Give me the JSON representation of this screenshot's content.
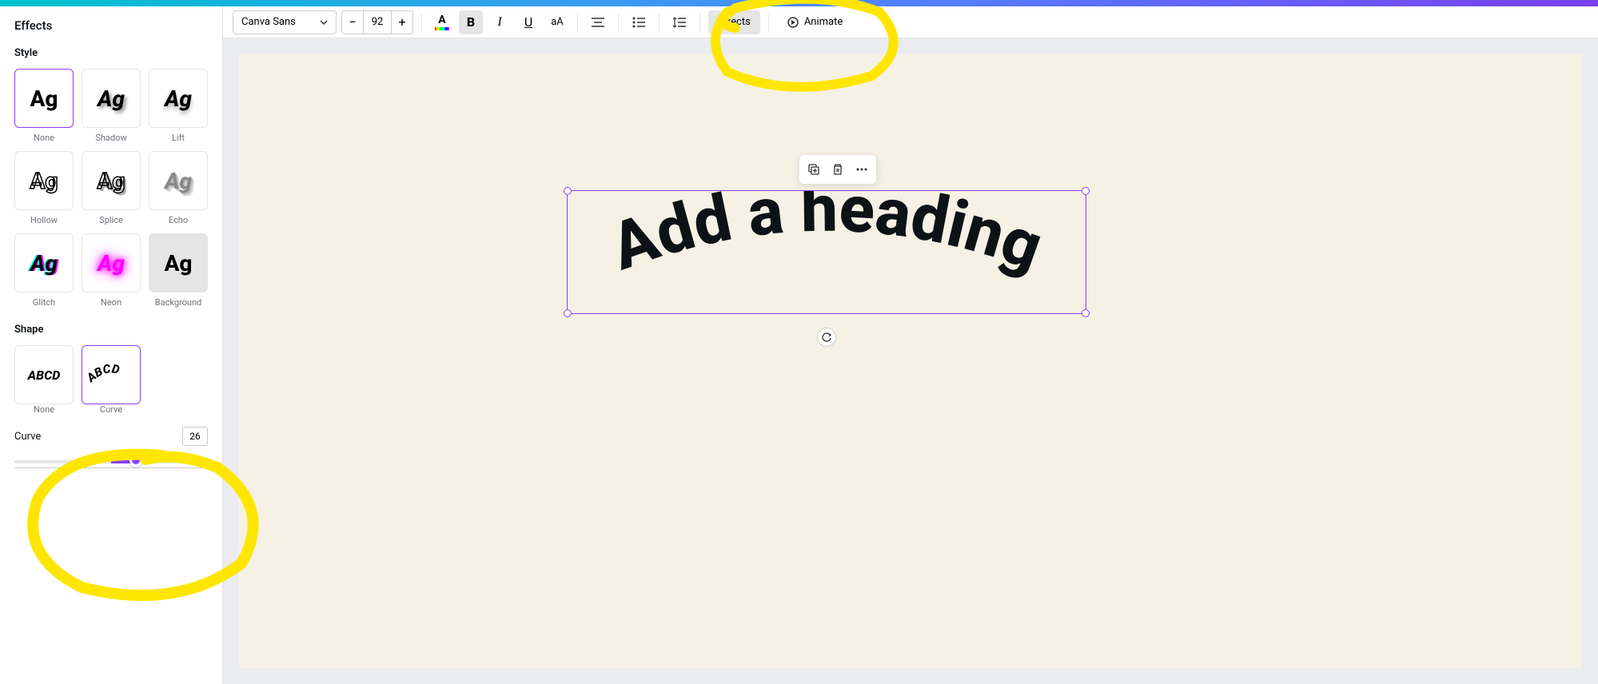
{
  "sidebar": {
    "title": "Effects",
    "style_label": "Style",
    "shape_label": "Shape",
    "effects": [
      {
        "label": "None",
        "sample": "Ag"
      },
      {
        "label": "Shadow",
        "sample": "Ag"
      },
      {
        "label": "Lift",
        "sample": "Ag"
      },
      {
        "label": "Hollow",
        "sample": "Ag"
      },
      {
        "label": "Splice",
        "sample": "Ag"
      },
      {
        "label": "Echo",
        "sample": "Ag"
      },
      {
        "label": "Glitch",
        "sample": "Ag"
      },
      {
        "label": "Neon",
        "sample": "Ag"
      },
      {
        "label": "Background",
        "sample": "Ag"
      }
    ],
    "shapes": [
      {
        "label": "None",
        "sample": "ABCD"
      },
      {
        "label": "Curve",
        "sample": "ABCD"
      }
    ],
    "curve_label": "Curve",
    "curve_value": "26"
  },
  "toolbar": {
    "font_name": "Canva Sans",
    "font_size": "92",
    "text_color_letter": "A",
    "bold": "B",
    "italic": "I",
    "underline": "U",
    "case": "aA",
    "effects_label": "Effects",
    "animate_label": "Animate"
  },
  "canvas": {
    "heading_text": "Add a heading"
  }
}
